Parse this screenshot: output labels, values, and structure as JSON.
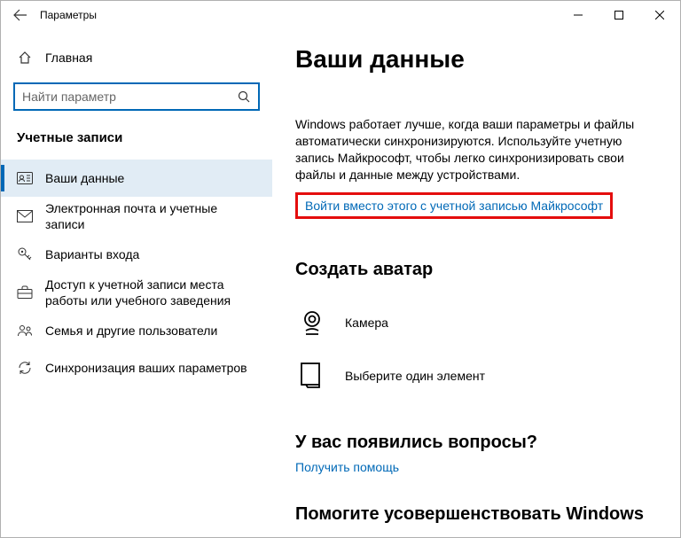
{
  "titlebar": {
    "title": "Параметры"
  },
  "sidebar": {
    "home_label": "Главная",
    "search_placeholder": "Найти параметр",
    "category": "Учетные записи",
    "items": [
      {
        "label": "Ваши данные"
      },
      {
        "label": "Электронная почта и учетные записи"
      },
      {
        "label": "Варианты входа"
      },
      {
        "label": "Доступ к учетной записи места работы или учебного заведения"
      },
      {
        "label": "Семья и другие пользователи"
      },
      {
        "label": "Синхронизация ваших параметров"
      }
    ]
  },
  "main": {
    "page_title": "Ваши данные",
    "sync_desc": "Windows работает лучше, когда ваши параметры и файлы автоматически синхронизируются. Используйте учетную запись Майкрософт, чтобы легко синхронизировать свои файлы и данные между устройствами.",
    "signin_link": "Войти вместо этого с учетной записью Майкрософт",
    "avatar_title": "Создать аватар",
    "avatar_options": [
      {
        "label": "Камера"
      },
      {
        "label": "Выберите один элемент"
      }
    ],
    "questions_title": "У вас появились вопросы?",
    "help_link": "Получить помощь",
    "improve_title": "Помогите усовершенствовать Windows"
  }
}
